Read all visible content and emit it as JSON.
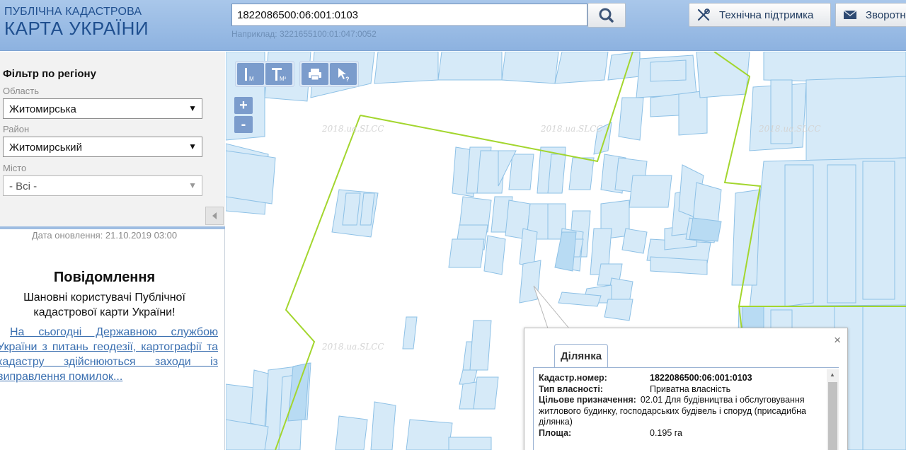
{
  "header": {
    "logo_line1": "ПУБЛІЧНА КАДАСТРОВА",
    "logo_line2": "КАРТА УКРАЇНИ",
    "search_value": "1822086500:06:001:0103",
    "search_hint": "Наприклад: 3221655100:01:047:0052",
    "support_label": "Технічна підтримка",
    "feedback_label": "Зворотний зв'язок",
    "icons": [
      "search-icon",
      "tools-icon",
      "envelope-icon"
    ]
  },
  "sidebar": {
    "filter_title": "Фільтр по регіону",
    "region_label": "Область",
    "region_value": "Житомирська",
    "district_label": "Район",
    "district_value": "Житомирський",
    "city_label": "Місто",
    "city_value": "- Всі -",
    "update_date": "Дата оновлення: 21.10.2019 03:00",
    "notice_title": "Повідомлення",
    "notice_greeting": "Шановні користувачі Публічної кадастрової карти України!",
    "notice_link": "На сьогодні Державною службою України з питань геодезії, картографії та кадастру здійснюються заходи із виправлення помилок..."
  },
  "map": {
    "tools": [
      "measure-distance-icon",
      "measure-area-icon",
      "print-icon",
      "info-cursor-icon"
    ],
    "zoom_in": "+",
    "zoom_out": "-",
    "watermark": "2018.ua.SLCC",
    "colors": {
      "parcel_fill": "#d6eaf8",
      "parcel_stroke": "#8ec1e6",
      "boundary": "#a3d62e"
    }
  },
  "popup": {
    "tab_label": "Ділянка",
    "close_label": "×",
    "rows": [
      {
        "key": "Кадастр.номер:",
        "value": "1822086500:06:001:0103",
        "bold": true
      },
      {
        "key": "Тип власності:",
        "value": "Приватна власність"
      },
      {
        "key": "Цільове призначення:",
        "value": "02.01 Для будівництва і обслуговування житлового будинку, господарських будівель і споруд (присадибна ділянка)"
      },
      {
        "key": "Площа:",
        "value": "0.195 га"
      }
    ]
  }
}
